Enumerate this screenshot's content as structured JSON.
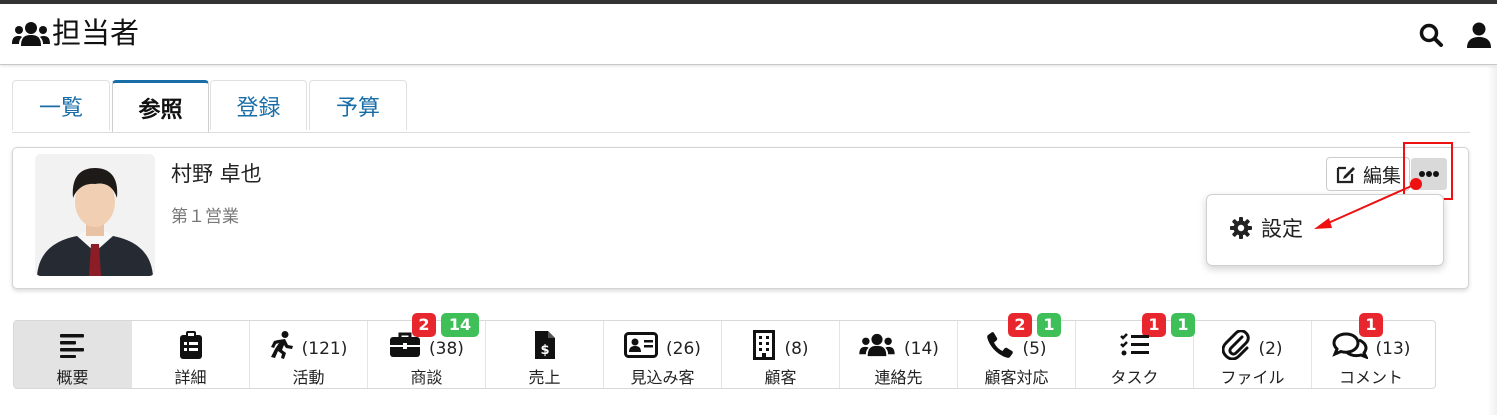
{
  "header": {
    "title": "担当者",
    "title_icon": "users-icon",
    "search_icon": "search-icon",
    "user_icon": "user-icon"
  },
  "tabs": [
    {
      "label": "一覧",
      "active": false
    },
    {
      "label": "参照",
      "active": true
    },
    {
      "label": "登録",
      "active": false
    },
    {
      "label": "予算",
      "active": false
    }
  ],
  "profile": {
    "name": "村野 卓也",
    "department": "第１営業",
    "edit_label": "編集",
    "more_icon": "ellipsis-icon"
  },
  "dropdown": {
    "item_label": "設定",
    "item_icon": "gear-icon"
  },
  "colors": {
    "accent": "#1a6ea8",
    "badge_red": "#e8262d",
    "badge_green": "#3fbf58",
    "annotation": "#e11111"
  },
  "nav": [
    {
      "label": "概要",
      "count": "",
      "icon": "list-icon",
      "active": true,
      "badges": []
    },
    {
      "label": "詳細",
      "count": "",
      "icon": "clipboard-icon",
      "active": false,
      "badges": []
    },
    {
      "label": "活動",
      "count": "(121)",
      "icon": "running-icon",
      "active": false,
      "badges": []
    },
    {
      "label": "商談",
      "count": "(38)",
      "icon": "briefcase-icon",
      "active": false,
      "badges": [
        {
          "value": "2",
          "color": "red"
        },
        {
          "value": "14",
          "color": "green"
        }
      ]
    },
    {
      "label": "売上",
      "count": "",
      "icon": "invoice-dollar-icon",
      "active": false,
      "badges": []
    },
    {
      "label": "見込み客",
      "count": "(26)",
      "icon": "id-card-icon",
      "active": false,
      "badges": []
    },
    {
      "label": "顧客",
      "count": "(8)",
      "icon": "building-icon",
      "active": false,
      "badges": []
    },
    {
      "label": "連絡先",
      "count": "(14)",
      "icon": "users-icon",
      "active": false,
      "badges": []
    },
    {
      "label": "顧客対応",
      "count": "(5)",
      "icon": "phone-icon",
      "active": false,
      "badges": [
        {
          "value": "2",
          "color": "red"
        },
        {
          "value": "1",
          "color": "green"
        }
      ]
    },
    {
      "label": "タスク",
      "count": "",
      "icon": "tasks-icon",
      "active": false,
      "badges": [
        {
          "value": "1",
          "color": "red"
        },
        {
          "value": "1",
          "color": "green"
        }
      ]
    },
    {
      "label": "ファイル",
      "count": "(2)",
      "icon": "paperclip-icon",
      "active": false,
      "badges": []
    },
    {
      "label": "コメント",
      "count": "(13)",
      "icon": "comments-icon",
      "active": false,
      "badges": [
        {
          "value": "1",
          "color": "red"
        }
      ]
    }
  ]
}
